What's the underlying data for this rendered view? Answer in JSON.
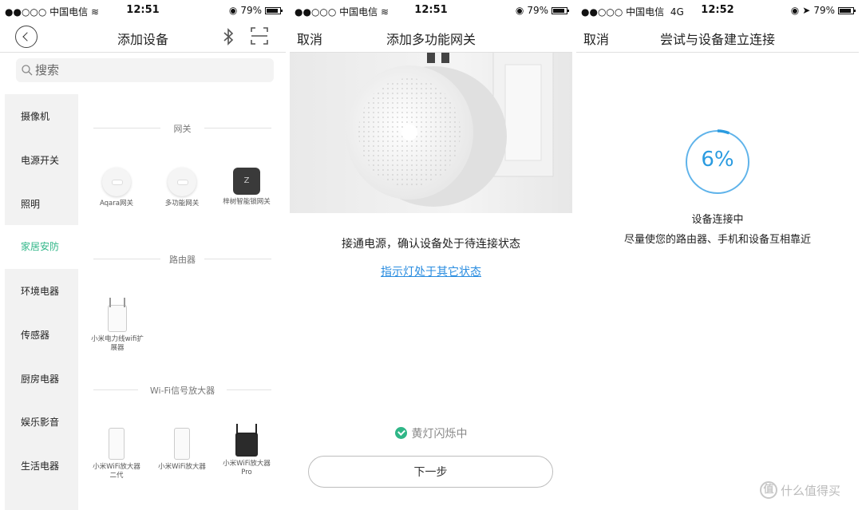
{
  "colors": {
    "accent_green": "#2fb687",
    "link_blue": "#2a8de0",
    "progress_blue": "#2a9be0"
  },
  "panel1": {
    "status": {
      "carrier": "●●○○○ 中国电信",
      "signal_icon": "wifi-icon",
      "time": "12:51",
      "battery": "79%"
    },
    "nav": {
      "title": "添加设备",
      "icons": [
        "back-icon",
        "bluetooth-icon",
        "scan-icon"
      ]
    },
    "search": {
      "placeholder": "搜索"
    },
    "sidebar": [
      {
        "label": "摄像机"
      },
      {
        "label": "电源开关"
      },
      {
        "label": "照明"
      },
      {
        "label": "家居安防",
        "active": true
      },
      {
        "label": "环境电器"
      },
      {
        "label": "传感器"
      },
      {
        "label": "厨房电器"
      },
      {
        "label": "娱乐影音"
      },
      {
        "label": "生活电器"
      }
    ],
    "sections": [
      {
        "title": "网关",
        "devices": [
          "Aqara网关",
          "多功能网关",
          "梓树智能锁网关"
        ]
      },
      {
        "title": "路由器",
        "devices": [
          "小米电力线wifi扩展器"
        ]
      },
      {
        "title": "Wi-Fi信号放大器",
        "devices": [
          "小米WiFi放大器二代",
          "小米WiFi放大器",
          "小米WiFi放大器Pro"
        ]
      }
    ]
  },
  "panel2": {
    "status": {
      "carrier": "●●○○○ 中国电信",
      "time": "12:51",
      "battery": "79%"
    },
    "nav": {
      "cancel": "取消",
      "title": "添加多功能网关"
    },
    "instruction": "接通电源，确认设备处于待连接状态",
    "link": "指示灯处于其它状态",
    "check_label": "黄灯闪烁中",
    "next_button": "下一步"
  },
  "panel3": {
    "status": {
      "carrier": "●●○○○ 中国电信",
      "network": "4G",
      "time": "12:52",
      "battery": "79%"
    },
    "nav": {
      "cancel": "取消",
      "title": "尝试与设备建立连接"
    },
    "progress": {
      "value": 6,
      "label": "6%"
    },
    "status_text": "设备连接中",
    "hint": "尽量使您的路由器、手机和设备互相靠近",
    "watermark": "什么值得买",
    "watermark_logo": "值"
  }
}
